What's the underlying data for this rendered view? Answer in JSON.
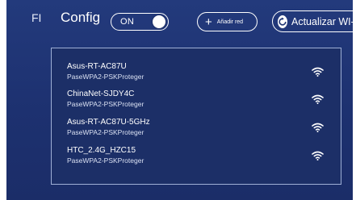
{
  "header": {
    "left_text": "FI",
    "title": "Config",
    "toggle": {
      "label": "ON"
    },
    "add_button": {
      "label": "Añadir red"
    },
    "update_button": {
      "label": "Actualizar WI-FI"
    }
  },
  "networks": [
    {
      "ssid": "Asus-RT-AC87U",
      "security": "PaseWPA2-PSKProteger",
      "icon": "wifi-icon"
    },
    {
      "ssid": "ChinaNet-SJDY4C",
      "security": "PaseWPA2-PSKProteger",
      "icon": "wifi-icon"
    },
    {
      "ssid": "Asus-RT-AC87U-5GHz",
      "security": "PaseWPA2-PSKProteger",
      "icon": "wifi-icon"
    },
    {
      "ssid": "HTC_2.4G_HZC15",
      "security": "PaseWPA2-PSKProteger",
      "icon": "wifi-icon"
    }
  ],
  "colors": {
    "background": "#1f3473",
    "panel": "#1c2f67",
    "accent": "#ffffff"
  }
}
